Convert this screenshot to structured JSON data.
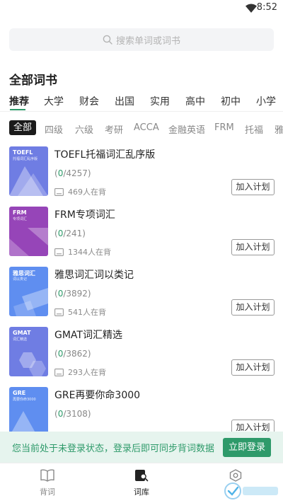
{
  "status_bar": {
    "time": "8:52"
  },
  "search": {
    "placeholder": "搜索单词或词书"
  },
  "section_title": "全部词书",
  "category_tabs": [
    "推荐",
    "大学",
    "财会",
    "出国",
    "实用",
    "高中",
    "初中",
    "小学"
  ],
  "active_category": "推荐",
  "sub_tabs": [
    "全部",
    "四级",
    "六级",
    "考研",
    "ACCA",
    "金融英语",
    "FRM",
    "托福",
    "雅"
  ],
  "active_sub_tab": "全部",
  "books": [
    {
      "title": "TOEFL托福词汇乱序版",
      "cover_title": "TOEFL",
      "cover_subtitle": "托福词汇乱序版",
      "cover_color": "#6f7de3",
      "done": "0",
      "total": "/4257)",
      "learners": "469人在背",
      "add_label": "加入计划"
    },
    {
      "title": "FRM专项词汇",
      "cover_title": "FRM",
      "cover_subtitle": "专项词汇",
      "cover_color": "#9645b8",
      "done": "0",
      "total": "/241)",
      "learners": "1344人在背",
      "add_label": "加入计划"
    },
    {
      "title": "雅思词汇词以类记",
      "cover_title": "雅思词汇",
      "cover_subtitle": "词以类记",
      "cover_color": "#5f8ef0",
      "done": "0",
      "total": "/3892)",
      "learners": "541人在背",
      "add_label": "加入计划"
    },
    {
      "title": "GMAT词汇精选",
      "cover_title": "GMAT",
      "cover_subtitle": "词汇精选",
      "cover_color": "#6f7de3",
      "done": "0",
      "total": "/3862)",
      "learners": "293人在背",
      "add_label": "加入计划"
    },
    {
      "title": "GRE再要你命3000",
      "cover_title": "GRE",
      "cover_subtitle": "再要你命3000",
      "cover_color": "#5f8ef0",
      "done": "0",
      "total": "/3108)",
      "learners": "",
      "add_label": "加入计划"
    }
  ],
  "login_banner": {
    "message": "您当前处于未登录状态，登录后即可同步背词数据",
    "button": "立即登录"
  },
  "bottom_nav": [
    {
      "label": "背词",
      "icon": "book-icon"
    },
    {
      "label": "词库",
      "icon": "library-search-icon"
    },
    {
      "label": "",
      "icon": "settings-icon"
    }
  ],
  "colors": {
    "accent": "#2e9a6a",
    "banner_bg": "#e6f4ee"
  }
}
